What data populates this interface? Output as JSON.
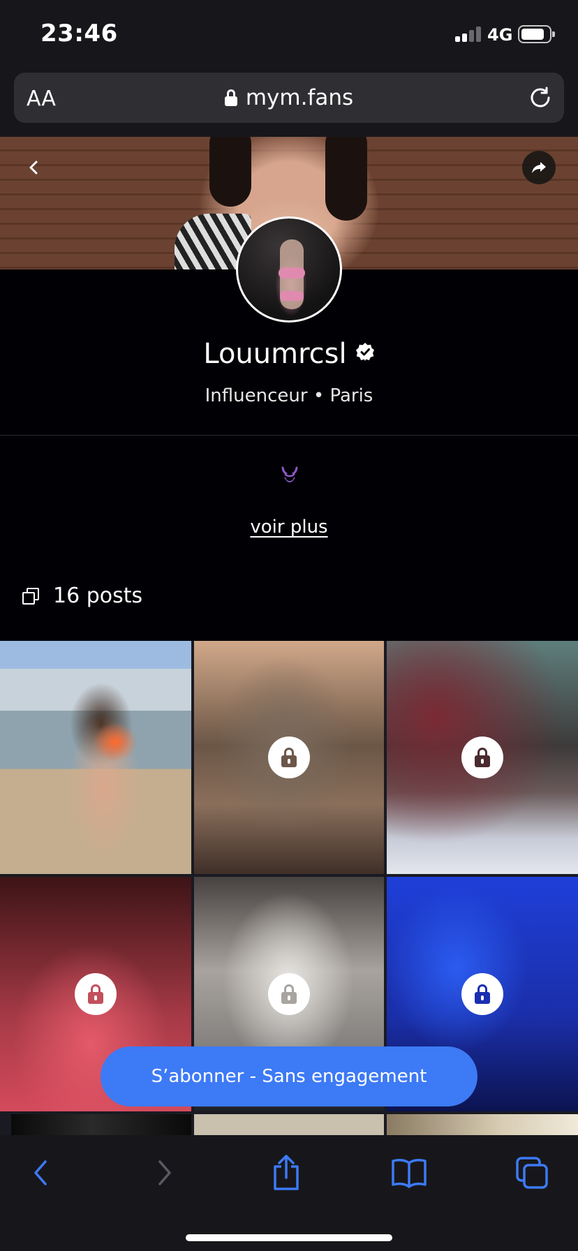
{
  "status_bar": {
    "time": "23:46",
    "network": "4G"
  },
  "browser": {
    "text_size_label": "AA",
    "url": "mym.fans"
  },
  "profile": {
    "name": "Louumrcsl",
    "subtitle": "Influenceur • Paris",
    "see_more_label": "voir plus",
    "posts_count_label": "16 posts",
    "verified": true
  },
  "grid": {
    "tiles": [
      {
        "locked": false,
        "lock_color": ""
      },
      {
        "locked": true,
        "lock_color": "#6b574a"
      },
      {
        "locked": true,
        "lock_color": "#4a2a2e"
      },
      {
        "locked": true,
        "lock_color": "#c2505c"
      },
      {
        "locked": true,
        "lock_color": "#a8a4a0"
      },
      {
        "locked": true,
        "lock_color": "#1a2eb0"
      }
    ]
  },
  "subscribe_button_label": "S’abonner - Sans engagement",
  "colors": {
    "accent": "#3d7af5",
    "chrome_bg": "#17171b",
    "page_bg": "#000005",
    "toolbar_icon": "#3d7af5",
    "toolbar_icon_disabled": "#5a5a62"
  }
}
